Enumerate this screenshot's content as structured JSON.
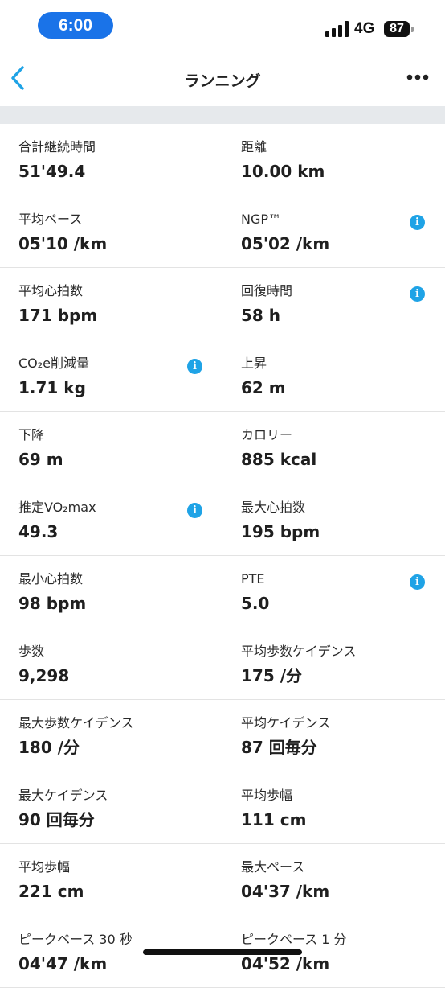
{
  "status_bar": {
    "time": "6:00",
    "network": "4G",
    "battery": "87"
  },
  "header": {
    "title": "ランニング",
    "back_icon": "chevron-left-icon",
    "more_icon": "more-horizontal-icon"
  },
  "colors": {
    "accent": "#1fa3e6",
    "time_pill": "#1a73e8",
    "band": "#e6e9ec"
  },
  "stats": [
    {
      "label": "合計継続時間",
      "value": "51'49.4",
      "info": false
    },
    {
      "label": "距離",
      "value": "10.00 km",
      "info": false
    },
    {
      "label": "平均ペース",
      "value": "05'10 /km",
      "info": false
    },
    {
      "label": "NGP™",
      "value": "05'02 /km",
      "info": true
    },
    {
      "label": "平均心拍数",
      "value": "171 bpm",
      "info": false
    },
    {
      "label": "回復時間",
      "value": "58 h",
      "info": true
    },
    {
      "label": "CO₂e削減量",
      "value": "1.71 kg",
      "info": true
    },
    {
      "label": "上昇",
      "value": "62 m",
      "info": false
    },
    {
      "label": "下降",
      "value": "69 m",
      "info": false
    },
    {
      "label": "カロリー",
      "value": "885 kcal",
      "info": false
    },
    {
      "label": "推定VO₂max",
      "value": "49.3",
      "info": true
    },
    {
      "label": "最大心拍数",
      "value": "195 bpm",
      "info": false
    },
    {
      "label": "最小心拍数",
      "value": "98 bpm",
      "info": false
    },
    {
      "label": "PTE",
      "value": "5.0",
      "info": true
    },
    {
      "label": "歩数",
      "value": "9,298",
      "info": false
    },
    {
      "label": "平均歩数ケイデンス",
      "value": "175 /分",
      "info": false
    },
    {
      "label": "最大歩数ケイデンス",
      "value": "180 /分",
      "info": false
    },
    {
      "label": "平均ケイデンス",
      "value": "87 回毎分",
      "info": false
    },
    {
      "label": "最大ケイデンス",
      "value": "90 回毎分",
      "info": false
    },
    {
      "label": "平均歩幅",
      "value": "111 cm",
      "info": false
    },
    {
      "label": "平均歩幅",
      "value": "221 cm",
      "info": false
    },
    {
      "label": "最大ペース",
      "value": "04'37 /km",
      "info": false
    },
    {
      "label": "ピークペース 30 秒",
      "value": "04'47 /km",
      "info": false
    },
    {
      "label": "ピークペース 1 分",
      "value": "04'52 /km",
      "info": false
    }
  ]
}
